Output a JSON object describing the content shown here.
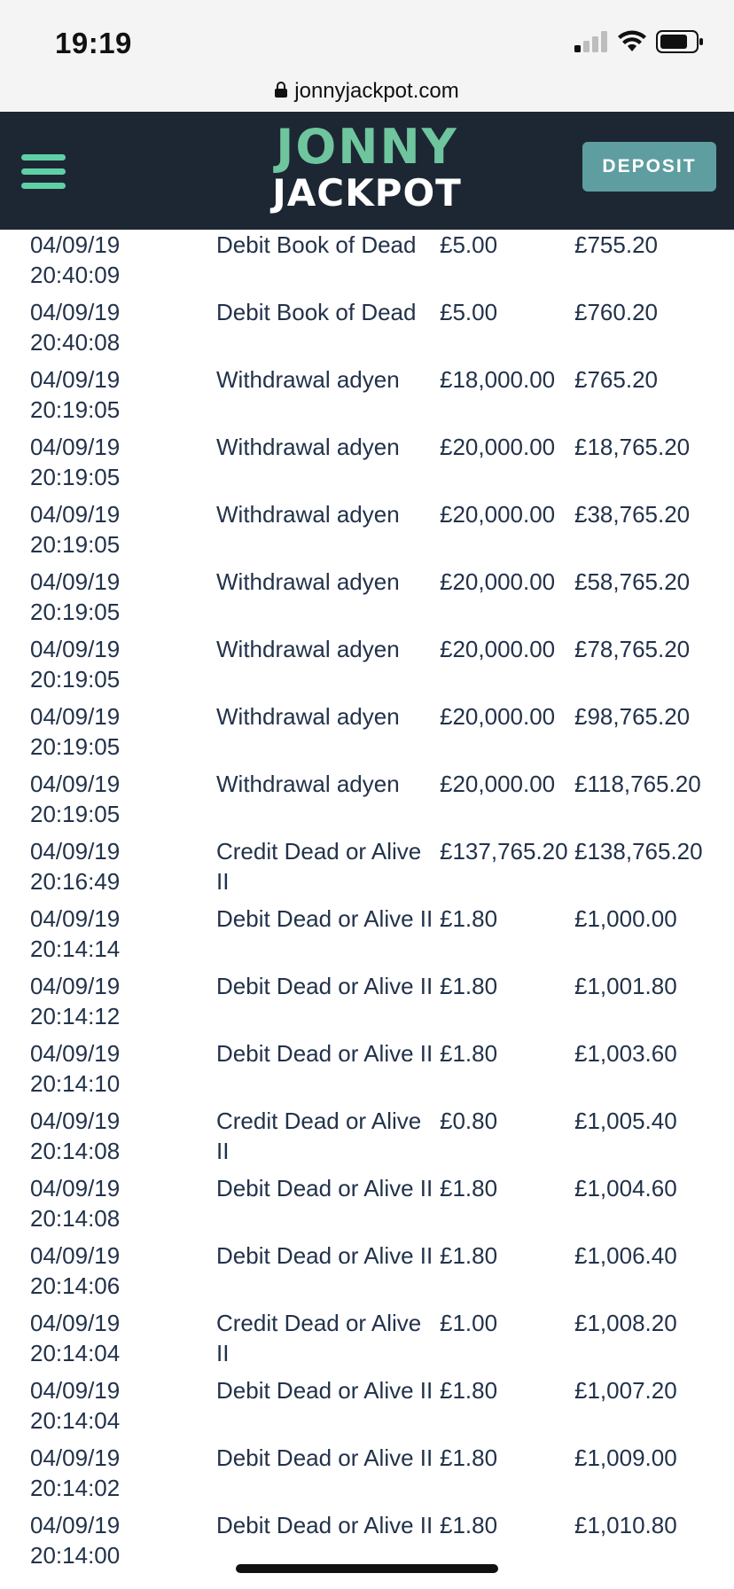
{
  "status_bar": {
    "time": "19:19"
  },
  "browser": {
    "url": "jonnyjackpot.com"
  },
  "header": {
    "logo_top": "JONNY",
    "logo_bottom": "JACKPOT",
    "deposit_label": "DEPOSIT",
    "colors": {
      "bar": "#1d2733",
      "accent": "#5fd0a6",
      "deposit": "#5e9ea0"
    }
  },
  "transactions": [
    {
      "date": "04/09/19",
      "time": "20:40:09",
      "description": "Debit Book of Dead",
      "amount": "£5.00",
      "balance": "£755.20"
    },
    {
      "date": "04/09/19",
      "time": "20:40:08",
      "description": "Debit Book of Dead",
      "amount": "£5.00",
      "balance": "£760.20"
    },
    {
      "date": "04/09/19",
      "time": "20:19:05",
      "description": "Withdrawal adyen",
      "amount": "£18,000.00",
      "balance": "£765.20"
    },
    {
      "date": "04/09/19",
      "time": "20:19:05",
      "description": "Withdrawal adyen",
      "amount": "£20,000.00",
      "balance": "£18,765.20"
    },
    {
      "date": "04/09/19",
      "time": "20:19:05",
      "description": "Withdrawal adyen",
      "amount": "£20,000.00",
      "balance": "£38,765.20"
    },
    {
      "date": "04/09/19",
      "time": "20:19:05",
      "description": "Withdrawal adyen",
      "amount": "£20,000.00",
      "balance": "£58,765.20"
    },
    {
      "date": "04/09/19",
      "time": "20:19:05",
      "description": "Withdrawal adyen",
      "amount": "£20,000.00",
      "balance": "£78,765.20"
    },
    {
      "date": "04/09/19",
      "time": "20:19:05",
      "description": "Withdrawal adyen",
      "amount": "£20,000.00",
      "balance": "£98,765.20"
    },
    {
      "date": "04/09/19",
      "time": "20:19:05",
      "description": "Withdrawal adyen",
      "amount": "£20,000.00",
      "balance": "£118,765.20"
    },
    {
      "date": "04/09/19",
      "time": "20:16:49",
      "description": "Credit Dead or Alive II",
      "amount": "£137,765.20",
      "balance": "£138,765.20"
    },
    {
      "date": "04/09/19",
      "time": "20:14:14",
      "description": "Debit Dead or Alive II",
      "amount": "£1.80",
      "balance": "£1,000.00"
    },
    {
      "date": "04/09/19",
      "time": "20:14:12",
      "description": "Debit Dead or Alive II",
      "amount": "£1.80",
      "balance": "£1,001.80"
    },
    {
      "date": "04/09/19",
      "time": "20:14:10",
      "description": "Debit Dead or Alive II",
      "amount": "£1.80",
      "balance": "£1,003.60"
    },
    {
      "date": "04/09/19",
      "time": "20:14:08",
      "description": "Credit Dead or Alive II",
      "amount": "£0.80",
      "balance": "£1,005.40"
    },
    {
      "date": "04/09/19",
      "time": "20:14:08",
      "description": "Debit Dead or Alive II",
      "amount": "£1.80",
      "balance": "£1,004.60"
    },
    {
      "date": "04/09/19",
      "time": "20:14:06",
      "description": "Debit Dead or Alive II",
      "amount": "£1.80",
      "balance": "£1,006.40"
    },
    {
      "date": "04/09/19",
      "time": "20:14:04",
      "description": "Credit Dead or Alive II",
      "amount": "£1.00",
      "balance": "£1,008.20"
    },
    {
      "date": "04/09/19",
      "time": "20:14:04",
      "description": "Debit Dead or Alive II",
      "amount": "£1.80",
      "balance": "£1,007.20"
    },
    {
      "date": "04/09/19",
      "time": "20:14:02",
      "description": "Debit Dead or Alive II",
      "amount": "£1.80",
      "balance": "£1,009.00"
    },
    {
      "date": "04/09/19",
      "time": "20:14:00",
      "description": "Debit Dead or Alive II",
      "amount": "£1.80",
      "balance": "£1,010.80"
    }
  ]
}
